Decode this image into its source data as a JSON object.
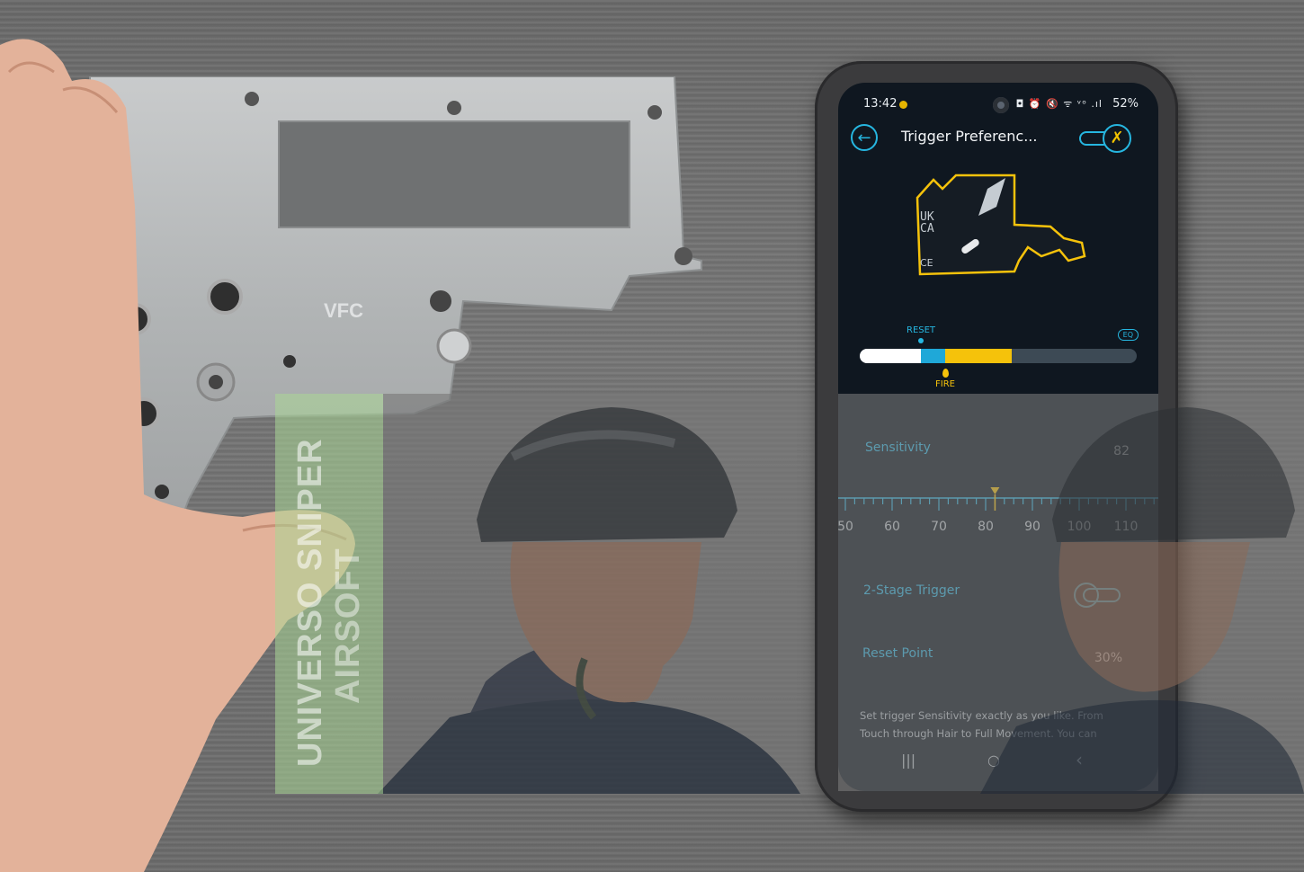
{
  "phone": {
    "status": {
      "time": "13:42",
      "icons": "◘ ⏰ 🔇 ᯤ ᵛᵒ .ıl",
      "battery": "52%"
    },
    "app_title": "Trigger Preferenc...",
    "back_icon": "←",
    "mode_icon": "✗",
    "trigger_marks": {
      "uk": "UK",
      "ca": "CA",
      "ce": "CE"
    },
    "reset_label": "RESET",
    "fire_label": "FIRE",
    "eq_label": "EQ",
    "travel_bar": {
      "white_fraction": 0.22,
      "blue_fraction": 0.09,
      "yellow_fraction": 0.24
    },
    "sensitivity": {
      "label": "Sensitivity",
      "value": "82",
      "ticks": [
        "50",
        "60",
        "70",
        "80",
        "90",
        "100",
        "110"
      ]
    },
    "two_stage": {
      "label": "2-Stage Trigger",
      "enabled": false
    },
    "reset_point": {
      "label": "Reset Point",
      "value": "30%"
    },
    "description": "Set trigger Sensitivity exactly as you like. From Touch through Hair to Full Movement. You can",
    "nav": {
      "recent": "|||",
      "home": "○",
      "back": "‹"
    }
  },
  "gearbox": {
    "brand": "VFC"
  },
  "banner": {
    "line1": "UNIVERSO SNIPER",
    "line2": "AIRSOFT"
  },
  "colors": {
    "accent_blue": "#26b6e0",
    "accent_yellow": "#f5c20b",
    "banner_green": "#aad796"
  }
}
